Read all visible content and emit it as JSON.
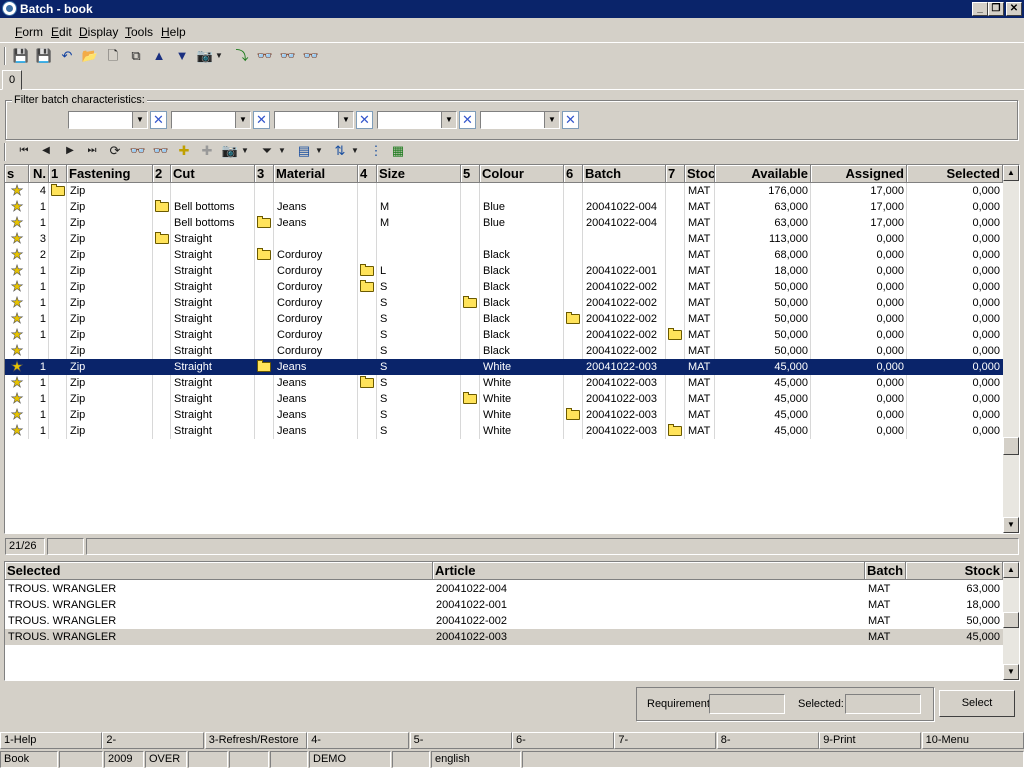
{
  "window": {
    "title": "Batch - book"
  },
  "menu": [
    "Form",
    "Edit",
    "Display",
    "Tools",
    "Help"
  ],
  "tabs": [
    "0"
  ],
  "filter": {
    "legend": "Filter batch characteristics:"
  },
  "grid": {
    "headers": [
      "s",
      "N.",
      "1",
      "Fastening",
      "2",
      "Cut",
      "3",
      "Material",
      "4",
      "Size",
      "5",
      "Colour",
      "6",
      "Batch",
      "7",
      "Stoc",
      "Available",
      "Assigned",
      "Selected"
    ],
    "rows": [
      {
        "n": "4",
        "fastening": "Zip",
        "cut": "",
        "material": "",
        "size": "",
        "colour": "",
        "batch": "",
        "stock": "MAT",
        "available": "176,000",
        "assigned": "17,000",
        "selected": "0,000",
        "folder": 1,
        "selected_row": false
      },
      {
        "n": "1",
        "fastening": "Zip",
        "cut": "Bell bottoms",
        "material": "Jeans",
        "size": "M",
        "colour": "Blue",
        "batch": "20041022-004",
        "stock": "MAT",
        "available": "63,000",
        "assigned": "17,000",
        "selected": "0,000",
        "folder": 2,
        "selected_row": false
      },
      {
        "n": "1",
        "fastening": "Zip",
        "cut": "Bell bottoms",
        "material": "Jeans",
        "size": "M",
        "colour": "Blue",
        "batch": "20041022-004",
        "stock": "MAT",
        "available": "63,000",
        "assigned": "17,000",
        "selected": "0,000",
        "folder": 3,
        "selected_row": false
      },
      {
        "n": "3",
        "fastening": "Zip",
        "cut": "Straight",
        "material": "",
        "size": "",
        "colour": "",
        "batch": "",
        "stock": "MAT",
        "available": "113,000",
        "assigned": "0,000",
        "selected": "0,000",
        "folder": 2,
        "selected_row": false
      },
      {
        "n": "2",
        "fastening": "Zip",
        "cut": "Straight",
        "material": "Corduroy",
        "size": "",
        "colour": "Black",
        "batch": "",
        "stock": "MAT",
        "available": "68,000",
        "assigned": "0,000",
        "selected": "0,000",
        "folder": 3,
        "selected_row": false
      },
      {
        "n": "1",
        "fastening": "Zip",
        "cut": "Straight",
        "material": "Corduroy",
        "size": "L",
        "colour": "Black",
        "batch": "20041022-001",
        "stock": "MAT",
        "available": "18,000",
        "assigned": "0,000",
        "selected": "0,000",
        "folder": 4,
        "selected_row": false
      },
      {
        "n": "1",
        "fastening": "Zip",
        "cut": "Straight",
        "material": "Corduroy",
        "size": "S",
        "colour": "Black",
        "batch": "20041022-002",
        "stock": "MAT",
        "available": "50,000",
        "assigned": "0,000",
        "selected": "0,000",
        "folder": 4,
        "selected_row": false
      },
      {
        "n": "1",
        "fastening": "Zip",
        "cut": "Straight",
        "material": "Corduroy",
        "size": "S",
        "colour": "Black",
        "batch": "20041022-002",
        "stock": "MAT",
        "available": "50,000",
        "assigned": "0,000",
        "selected": "0,000",
        "folder": 5,
        "selected_row": false
      },
      {
        "n": "1",
        "fastening": "Zip",
        "cut": "Straight",
        "material": "Corduroy",
        "size": "S",
        "colour": "Black",
        "batch": "20041022-002",
        "stock": "MAT",
        "available": "50,000",
        "assigned": "0,000",
        "selected": "0,000",
        "folder": 6,
        "selected_row": false
      },
      {
        "n": "1",
        "fastening": "Zip",
        "cut": "Straight",
        "material": "Corduroy",
        "size": "S",
        "colour": "Black",
        "batch": "20041022-002",
        "stock": "MAT",
        "available": "50,000",
        "assigned": "0,000",
        "selected": "0,000",
        "folder": 7,
        "selected_row": false
      },
      {
        "n": "",
        "fastening": "Zip",
        "cut": "Straight",
        "material": "Corduroy",
        "size": "S",
        "colour": "Black",
        "batch": "20041022-002",
        "stock": "MAT",
        "available": "50,000",
        "assigned": "0,000",
        "selected": "0,000",
        "folder": 0,
        "selected_row": false
      },
      {
        "n": "1",
        "fastening": "Zip",
        "cut": "Straight",
        "material": "Jeans",
        "size": "S",
        "colour": "White",
        "batch": "20041022-003",
        "stock": "MAT",
        "available": "45,000",
        "assigned": "0,000",
        "selected": "0,000",
        "folder": 3,
        "selected_row": true
      },
      {
        "n": "1",
        "fastening": "Zip",
        "cut": "Straight",
        "material": "Jeans",
        "size": "S",
        "colour": "White",
        "batch": "20041022-003",
        "stock": "MAT",
        "available": "45,000",
        "assigned": "0,000",
        "selected": "0,000",
        "folder": 4,
        "selected_row": false
      },
      {
        "n": "1",
        "fastening": "Zip",
        "cut": "Straight",
        "material": "Jeans",
        "size": "S",
        "colour": "White",
        "batch": "20041022-003",
        "stock": "MAT",
        "available": "45,000",
        "assigned": "0,000",
        "selected": "0,000",
        "folder": 5,
        "selected_row": false
      },
      {
        "n": "1",
        "fastening": "Zip",
        "cut": "Straight",
        "material": "Jeans",
        "size": "S",
        "colour": "White",
        "batch": "20041022-003",
        "stock": "MAT",
        "available": "45,000",
        "assigned": "0,000",
        "selected": "0,000",
        "folder": 6,
        "selected_row": false
      },
      {
        "n": "1",
        "fastening": "Zip",
        "cut": "Straight",
        "material": "Jeans",
        "size": "S",
        "colour": "White",
        "batch": "20041022-003",
        "stock": "MAT",
        "available": "45,000",
        "assigned": "0,000",
        "selected": "0,000",
        "folder": 7,
        "selected_row": false
      }
    ]
  },
  "grid_status": {
    "position": "21/26"
  },
  "selected_grid": {
    "headers": [
      "Selected",
      "Article",
      "Batch",
      "Stock"
    ],
    "rows": [
      {
        "selected": "TROUS. WRANGLER",
        "article": "20041022-004",
        "batch": "MAT",
        "stock": "63,000"
      },
      {
        "selected": "TROUS. WRANGLER",
        "article": "20041022-001",
        "batch": "MAT",
        "stock": "18,000"
      },
      {
        "selected": "TROUS. WRANGLER",
        "article": "20041022-002",
        "batch": "MAT",
        "stock": "50,000"
      },
      {
        "selected": "TROUS. WRANGLER",
        "article": "20041022-003",
        "batch": "MAT",
        "stock": "45,000"
      }
    ]
  },
  "bottom": {
    "requirement_label": "Requirement",
    "selected_label": "Selected:",
    "select_button": "Select"
  },
  "fkeys": [
    "1-Help",
    "2-",
    "3-Refresh/Restore",
    "4-",
    "5-",
    "6-",
    "7-",
    "8-",
    "9-Print",
    "10-Menu"
  ],
  "statusbar": {
    "form": "Book",
    "year": "2009",
    "mode": "OVER",
    "company": "DEMO",
    "language": "english"
  }
}
